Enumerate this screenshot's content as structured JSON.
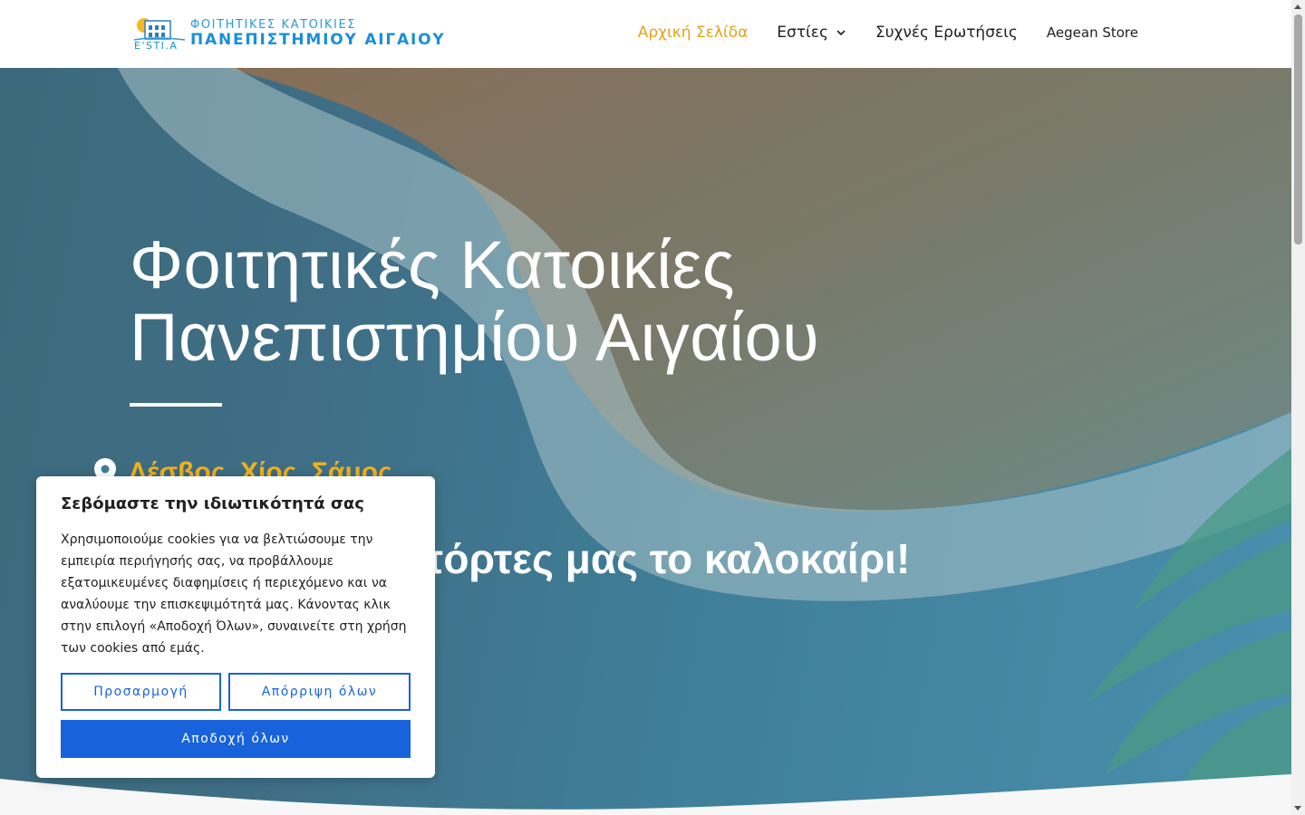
{
  "logo": {
    "line1": "ΦΟΙΤΗΤΙΚΕΣ ΚΑΤΟΙΚΙΕΣ",
    "line2": "ΠΑΝΕΠΙΣΤΗΜΙΟΥ ΑΙΓΑΙΟΥ",
    "brand": "E'STI.A"
  },
  "nav": {
    "items": [
      {
        "label": "Αρχική Σελίδα",
        "active": true
      },
      {
        "label": "Εστίες",
        "has_dropdown": true
      },
      {
        "label": "Συχνές Ερωτήσεις"
      },
      {
        "label": "Aegean Store"
      }
    ]
  },
  "hero": {
    "title_line1": "Φοιτητικές Κατοικίες",
    "title_line2": "Πανεπιστημίου Αιγαίου",
    "location": "Λέσβος, Χίος, Σάμος",
    "tagline": "Ανοίγουμε τις πόρτες μας το καλοκαίρι!"
  },
  "cookie": {
    "title": "Σεβόμαστε την ιδιωτικότητά σας",
    "text": "Χρησιμοποιούμε cookies για να βελτιώσουμε την εμπειρία περιήγησής σας, να προβάλλουμε εξατομικευμένες διαφημίσεις ή περιεχόμενο και να αναλύουμε την επισκεψιμότητά μας. Κάνοντας κλικ στην επιλογή «Αποδοχή Όλων», συναινείτε στη χρήση των cookies από εμάς.",
    "customize_label": "Προσαρμογή",
    "reject_label": "Απόρριψη όλων",
    "accept_label": "Αποδοχή όλων"
  },
  "colors": {
    "accent_active": "#e5a21a",
    "location": "#f2b21d",
    "button_primary": "#1863dc"
  },
  "icons": {
    "location": "map-pin-icon",
    "dropdown": "chevron-down-icon"
  }
}
